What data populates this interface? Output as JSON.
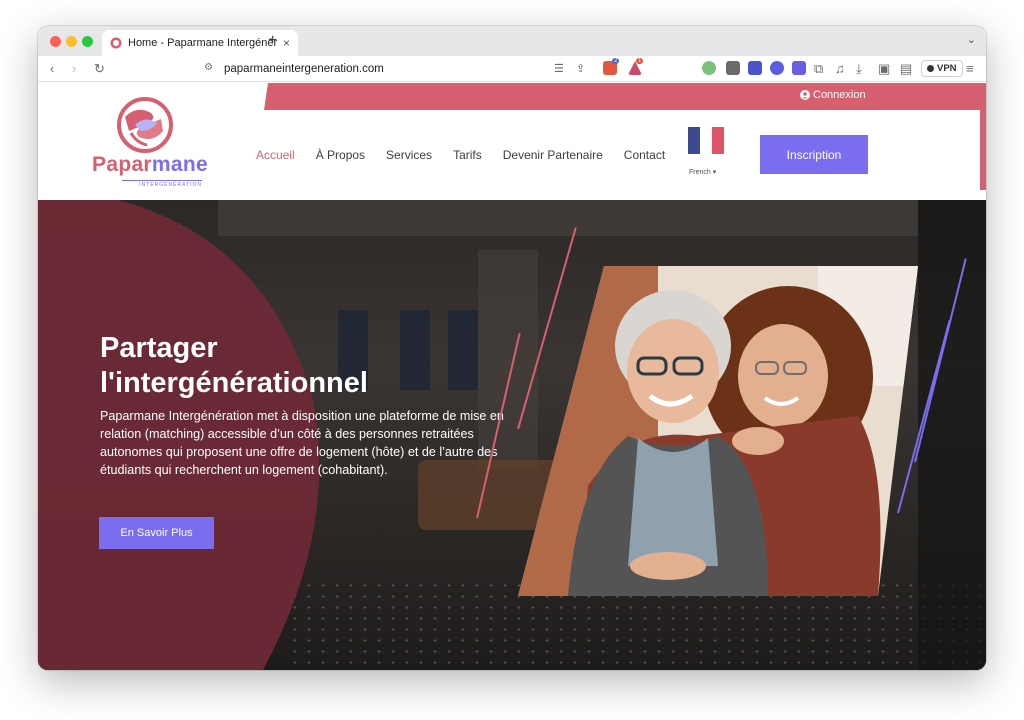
{
  "browser": {
    "tab_title": "Home - Paparmane Intergénéra",
    "url": "paparmaneintergeneration.com",
    "vpn_label": "VPN",
    "shield_badge": "2",
    "alert_badge": "1"
  },
  "header": {
    "connexion_label": "Connexion",
    "logo_name_1": "Papar",
    "logo_name_2": "mane",
    "logo_sub": "INTERGÉNÉRATION",
    "nav": [
      {
        "label": "Accueil"
      },
      {
        "label": "À Propos"
      },
      {
        "label": "Services"
      },
      {
        "label": "Tarifs"
      },
      {
        "label": "Devenir Partenaire"
      },
      {
        "label": "Contact"
      }
    ],
    "language": "French ▾",
    "inscription_label": "Inscription"
  },
  "hero": {
    "title": "Partager l'intergénérationnel",
    "text": "Paparmane Intergénération met à disposition une plateforme de mise en relation (matching) accessible d’un côté à des personnes retraitées autonomes qui proposent une offre de logement (hôte) et de l’autre des étudiants qui recherchent un logement (cohabitant).",
    "cta_label": "En Savoir Plus"
  },
  "colors": {
    "brand_pink": "#d6606f",
    "brand_violet": "#7b6df0",
    "hero_maroon": "#6e2a36"
  }
}
